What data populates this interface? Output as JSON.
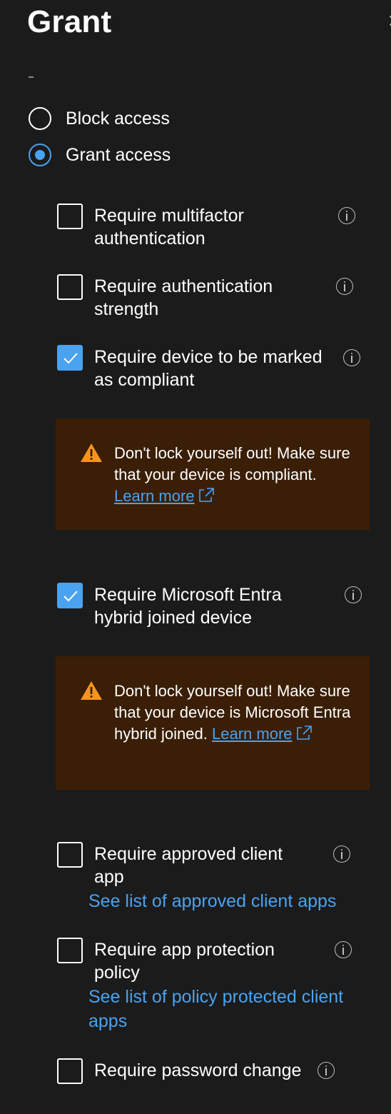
{
  "panel": {
    "title": "Grant",
    "close_icon": "close-icon"
  },
  "access": {
    "options": [
      {
        "label": "Block access",
        "selected": false
      },
      {
        "label": "Grant access",
        "selected": true
      }
    ]
  },
  "controls": {
    "mfa": {
      "label": "Require multifactor authentication",
      "checked": false,
      "icon": "info-icon"
    },
    "auth_strength": {
      "label": "Require authentication strength",
      "checked": false,
      "icon": "info-icon"
    },
    "compliant": {
      "label": "Require device to be marked as compliant",
      "checked": true,
      "icon": "info-icon"
    },
    "hybrid": {
      "label": "Require Microsoft Entra hybrid joined device",
      "checked": true,
      "icon": "info-icon"
    },
    "approved_app": {
      "label": "Require approved client app",
      "checked": false,
      "link": "See list of approved client apps",
      "icon": "info-icon"
    },
    "app_protection": {
      "label": "Require app protection policy",
      "checked": false,
      "link": "See list of policy protected client apps",
      "icon": "info-icon"
    },
    "password_change": {
      "label": "Require password change",
      "checked": false,
      "icon": "info-icon"
    }
  },
  "warnings": {
    "compliant": {
      "text": "Don't lock yourself out! Make sure that your device is compliant.",
      "link": "Learn more"
    },
    "hybrid": {
      "text": "Don't lock yourself out! Make sure that your device is Microsoft Entra hybrid joined.",
      "link": "Learn more"
    }
  },
  "colors": {
    "background": "#1b1b1b",
    "accent": "#4aa3f0",
    "warning_background": "#3a1e06",
    "warning_icon": "#f7941d"
  }
}
